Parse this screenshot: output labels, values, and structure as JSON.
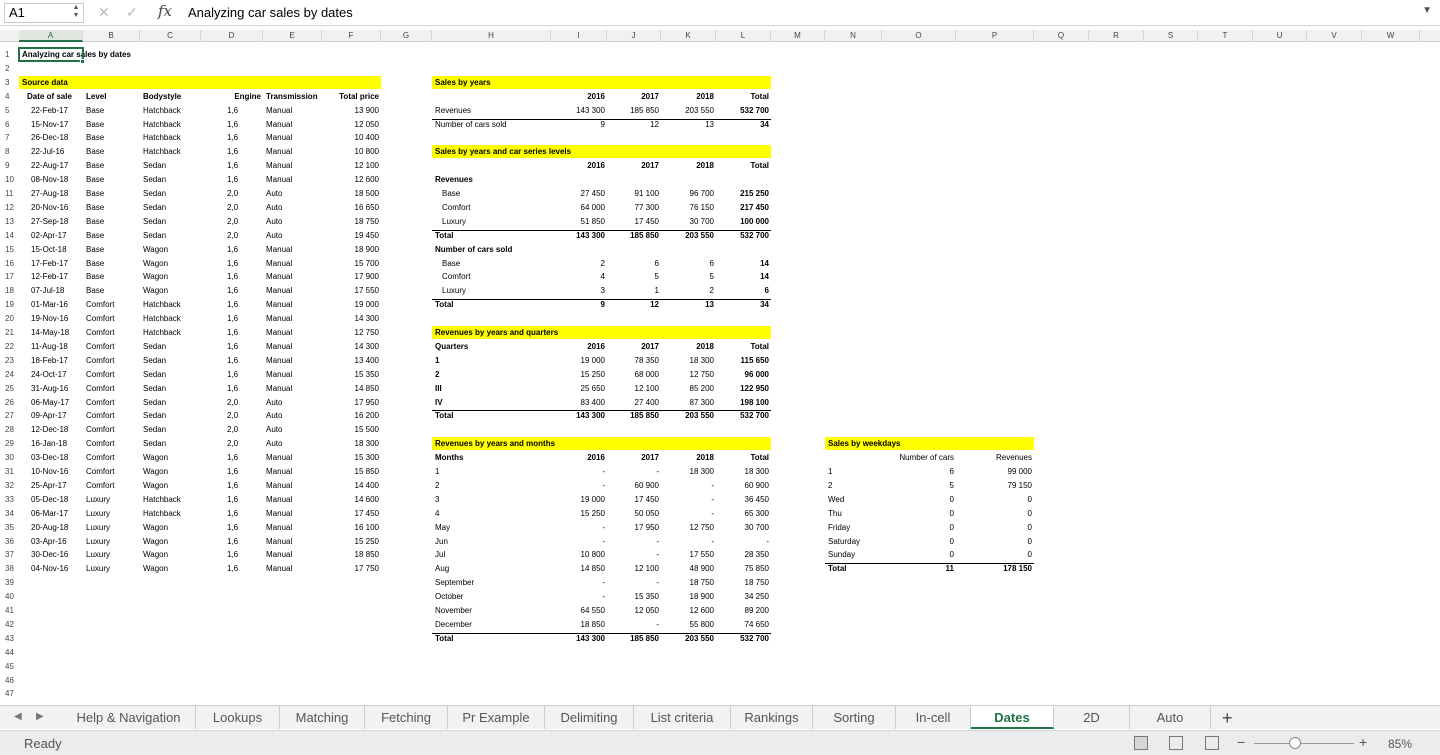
{
  "app": {
    "name_box": "A1",
    "fx": "fx",
    "formula": "Analyzing car sales by dates"
  },
  "columns": [
    "A",
    "B",
    "C",
    "D",
    "E",
    "F",
    "G",
    "H",
    "I",
    "J",
    "K",
    "L",
    "M",
    "N",
    "O",
    "P",
    "Q",
    "R",
    "S",
    "T",
    "U",
    "V",
    "W"
  ],
  "rows": [
    "1",
    "2",
    "3",
    "4",
    "5",
    "6",
    "7",
    "8",
    "9",
    "10",
    "11",
    "12",
    "13",
    "14",
    "15",
    "16",
    "17",
    "18",
    "19",
    "20",
    "21",
    "22",
    "23",
    "24",
    "25",
    "26",
    "27",
    "28",
    "29",
    "30",
    "31",
    "32",
    "33",
    "34",
    "35",
    "36",
    "37",
    "38",
    "39",
    "40",
    "41",
    "42",
    "43",
    "44",
    "45",
    "46",
    "47"
  ],
  "title": "Analyzing car sales by dates",
  "source": {
    "header": "Source data",
    "col_headers": [
      "Date of sale",
      "Level",
      "Bodystyle",
      "Engine",
      "Transmission",
      "Total price"
    ],
    "records": [
      [
        "22-Feb-17",
        "Base",
        "Hatchback",
        "1,6",
        "Manual",
        "13 900"
      ],
      [
        "15-Nov-17",
        "Base",
        "Hatchback",
        "1,6",
        "Manual",
        "12 050"
      ],
      [
        "26-Dec-18",
        "Base",
        "Hatchback",
        "1,6",
        "Manual",
        "10 400"
      ],
      [
        "22-Jul-16",
        "Base",
        "Hatchback",
        "1,6",
        "Manual",
        "10 800"
      ],
      [
        "22-Aug-17",
        "Base",
        "Sedan",
        "1,6",
        "Manual",
        "12 100"
      ],
      [
        "08-Nov-18",
        "Base",
        "Sedan",
        "1,6",
        "Manual",
        "12 600"
      ],
      [
        "27-Aug-18",
        "Base",
        "Sedan",
        "2,0",
        "Auto",
        "18 500"
      ],
      [
        "20-Nov-16",
        "Base",
        "Sedan",
        "2,0",
        "Auto",
        "16 650"
      ],
      [
        "27-Sep-18",
        "Base",
        "Sedan",
        "2,0",
        "Auto",
        "18 750"
      ],
      [
        "02-Apr-17",
        "Base",
        "Sedan",
        "2,0",
        "Auto",
        "19 450"
      ],
      [
        "15-Oct-18",
        "Base",
        "Wagon",
        "1,6",
        "Manual",
        "18 900"
      ],
      [
        "17-Feb-17",
        "Base",
        "Wagon",
        "1,6",
        "Manual",
        "15 700"
      ],
      [
        "12-Feb-17",
        "Base",
        "Wagon",
        "1,6",
        "Manual",
        "17 900"
      ],
      [
        "07-Jul-18",
        "Base",
        "Wagon",
        "1,6",
        "Manual",
        "17 550"
      ],
      [
        "01-Mar-16",
        "Comfort",
        "Hatchback",
        "1,6",
        "Manual",
        "19 000"
      ],
      [
        "19-Nov-16",
        "Comfort",
        "Hatchback",
        "1,6",
        "Manual",
        "14 300"
      ],
      [
        "14-May-18",
        "Comfort",
        "Hatchback",
        "1,6",
        "Manual",
        "12 750"
      ],
      [
        "11-Aug-18",
        "Comfort",
        "Sedan",
        "1,6",
        "Manual",
        "14 300"
      ],
      [
        "18-Feb-17",
        "Comfort",
        "Sedan",
        "1,6",
        "Manual",
        "13 400"
      ],
      [
        "24-Oct-17",
        "Comfort",
        "Sedan",
        "1,6",
        "Manual",
        "15 350"
      ],
      [
        "31-Aug-16",
        "Comfort",
        "Sedan",
        "1,6",
        "Manual",
        "14 850"
      ],
      [
        "06-May-17",
        "Comfort",
        "Sedan",
        "2,0",
        "Auto",
        "17 950"
      ],
      [
        "09-Apr-17",
        "Comfort",
        "Sedan",
        "2,0",
        "Auto",
        "16 200"
      ],
      [
        "12-Dec-18",
        "Comfort",
        "Sedan",
        "2,0",
        "Auto",
        "15 500"
      ],
      [
        "16-Jan-18",
        "Comfort",
        "Sedan",
        "2,0",
        "Auto",
        "18 300"
      ],
      [
        "03-Dec-18",
        "Comfort",
        "Wagon",
        "1,6",
        "Manual",
        "15 300"
      ],
      [
        "10-Nov-16",
        "Comfort",
        "Wagon",
        "1,6",
        "Manual",
        "15 850"
      ],
      [
        "25-Apr-17",
        "Comfort",
        "Wagon",
        "1,6",
        "Manual",
        "14 400"
      ],
      [
        "05-Dec-18",
        "Luxury",
        "Hatchback",
        "1,6",
        "Manual",
        "14 600"
      ],
      [
        "06-Mar-17",
        "Luxury",
        "Hatchback",
        "1,6",
        "Manual",
        "17 450"
      ],
      [
        "20-Aug-18",
        "Luxury",
        "Wagon",
        "1,6",
        "Manual",
        "16 100"
      ],
      [
        "03-Apr-16",
        "Luxury",
        "Wagon",
        "1,6",
        "Manual",
        "15 250"
      ],
      [
        "30-Dec-16",
        "Luxury",
        "Wagon",
        "1,6",
        "Manual",
        "18 850"
      ],
      [
        "04-Nov-16",
        "Luxury",
        "Wagon",
        "1,6",
        "Manual",
        "17 750"
      ]
    ]
  },
  "sales_by_years": {
    "header": "Sales by years",
    "col_headers": [
      "2016",
      "2017",
      "2018",
      "Total"
    ],
    "rows": [
      {
        "label": "Revenues",
        "values": [
          "143 300",
          "185 850",
          "203 550",
          "532 700"
        ]
      },
      {
        "label": "Number of cars sold",
        "values": [
          "9",
          "12",
          "13",
          "34"
        ]
      }
    ]
  },
  "sales_by_levels": {
    "header": "Sales by years and car series levels",
    "col_headers": [
      "2016",
      "2017",
      "2018",
      "Total"
    ],
    "rev_label": "Revenues",
    "rev_rows": [
      {
        "label": "Base",
        "values": [
          "27 450",
          "91 100",
          "96 700",
          "215 250"
        ]
      },
      {
        "label": "Comfort",
        "values": [
          "64 000",
          "77 300",
          "76 150",
          "217 450"
        ]
      },
      {
        "label": "Luxury",
        "values": [
          "51 850",
          "17 450",
          "30 700",
          "100 000"
        ]
      },
      {
        "label": "Total",
        "values": [
          "143 300",
          "185 850",
          "203 550",
          "532 700"
        ]
      }
    ],
    "cnt_label": "Number of cars sold",
    "cnt_rows": [
      {
        "label": "Base",
        "values": [
          "2",
          "6",
          "6",
          "14"
        ]
      },
      {
        "label": "Comfort",
        "values": [
          "4",
          "5",
          "5",
          "14"
        ]
      },
      {
        "label": "Luxury",
        "values": [
          "3",
          "1",
          "2",
          "6"
        ]
      },
      {
        "label": "Total",
        "values": [
          "9",
          "12",
          "13",
          "34"
        ]
      }
    ]
  },
  "rev_quarters": {
    "header": "Revenues by years and quarters",
    "col_headers": [
      "Quarters",
      "2016",
      "2017",
      "2018",
      "Total"
    ],
    "rows": [
      {
        "label": "1",
        "values": [
          "19 000",
          "78 350",
          "18 300",
          "115 650"
        ]
      },
      {
        "label": "2",
        "values": [
          "15 250",
          "68 000",
          "12 750",
          "96 000"
        ]
      },
      {
        "label": "III",
        "values": [
          "25 650",
          "12 100",
          "85 200",
          "122 950"
        ]
      },
      {
        "label": "IV",
        "values": [
          "83 400",
          "27 400",
          "87 300",
          "198 100"
        ]
      },
      {
        "label": "Total",
        "values": [
          "143 300",
          "185 850",
          "203 550",
          "532 700"
        ]
      }
    ]
  },
  "rev_months": {
    "header": "Revenues by years and months",
    "col_headers": [
      "Months",
      "2016",
      "2017",
      "2018",
      "Total"
    ],
    "rows": [
      {
        "label": "1",
        "values": [
          "-",
          "-",
          "18 300",
          "18 300"
        ]
      },
      {
        "label": "2",
        "values": [
          "-",
          "60 900",
          "-",
          "60 900"
        ]
      },
      {
        "label": "3",
        "values": [
          "19 000",
          "17 450",
          "-",
          "36 450"
        ]
      },
      {
        "label": "4",
        "values": [
          "15 250",
          "50 050",
          "-",
          "65 300"
        ]
      },
      {
        "label": "May",
        "values": [
          "-",
          "17 950",
          "12 750",
          "30 700"
        ]
      },
      {
        "label": "Jun",
        "values": [
          "-",
          "-",
          "-",
          "-"
        ]
      },
      {
        "label": "Jul",
        "values": [
          "10 800",
          "-",
          "17 550",
          "28 350"
        ]
      },
      {
        "label": "Aug",
        "values": [
          "14 850",
          "12 100",
          "48 900",
          "75 850"
        ]
      },
      {
        "label": "September",
        "values": [
          "-",
          "-",
          "18 750",
          "18 750"
        ]
      },
      {
        "label": "October",
        "values": [
          "-",
          "15 350",
          "18 900",
          "34 250"
        ]
      },
      {
        "label": "November",
        "values": [
          "64 550",
          "12 050",
          "12 600",
          "89 200"
        ]
      },
      {
        "label": "December",
        "values": [
          "18 850",
          "-",
          "55 800",
          "74 650"
        ]
      },
      {
        "label": "Total",
        "values": [
          "143 300",
          "185 850",
          "203 550",
          "532 700"
        ]
      }
    ]
  },
  "weekdays": {
    "header": "Sales by weekdays",
    "col_headers": [
      "Number of cars",
      "Revenues"
    ],
    "rows": [
      {
        "label": "1",
        "values": [
          "6",
          "99 000"
        ]
      },
      {
        "label": "2",
        "values": [
          "5",
          "79 150"
        ]
      },
      {
        "label": "Wed",
        "values": [
          "0",
          "0"
        ]
      },
      {
        "label": "Thu",
        "values": [
          "0",
          "0"
        ]
      },
      {
        "label": "Friday",
        "values": [
          "0",
          "0"
        ]
      },
      {
        "label": "Saturday",
        "values": [
          "0",
          "0"
        ]
      },
      {
        "label": "Sunday",
        "values": [
          "0",
          "0"
        ]
      },
      {
        "label": "Total",
        "values": [
          "11",
          "178 150"
        ]
      }
    ]
  },
  "tabs": [
    "Help & Navigation",
    "Lookups",
    "Matching",
    "Fetching",
    "Pr Example",
    "Delimiting",
    "List criteria",
    "Rankings",
    "Sorting",
    "In-cell",
    "Dates",
    "2D",
    "Auto"
  ],
  "active_tab": "Dates",
  "add_tab": "+",
  "status": {
    "text": "Ready",
    "zoom": "85%",
    "zoom_minus": "−",
    "zoom_plus": "+"
  },
  "colors": {
    "header_fill": "#ffff00",
    "accent": "#217346"
  }
}
